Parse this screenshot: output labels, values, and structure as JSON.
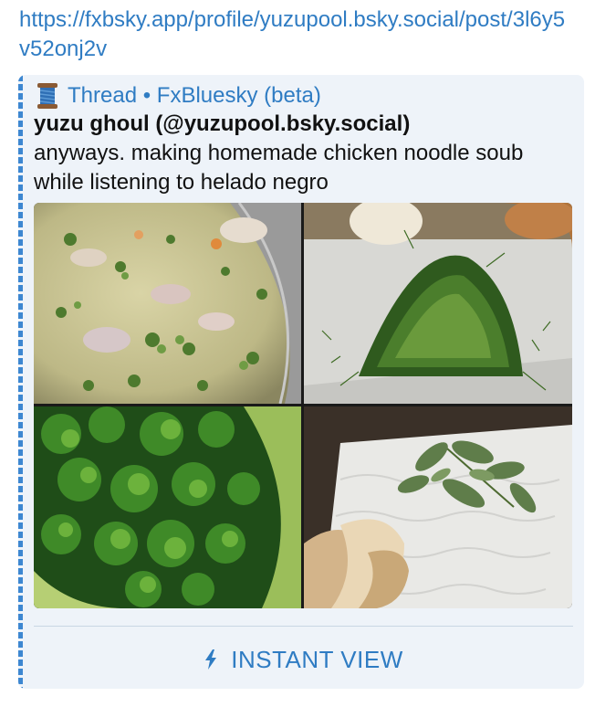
{
  "message": {
    "link_text": "https://fxbsky.app/profile/yuzupool.bsky.social/post/3l6y5v52onj2v"
  },
  "preview": {
    "site_icon": "thread-spool-icon",
    "site_name": "Thread • FxBluesky (beta)",
    "author": "yuzu ghoul (@yuzupool.bsky.social)",
    "text": "anyways. making homemade chicken noodle soub while listening to helado negro",
    "images": [
      {
        "name": "soup-photo"
      },
      {
        "name": "dill-photo"
      },
      {
        "name": "parsley-photo"
      },
      {
        "name": "sage-garlic-photo"
      }
    ],
    "instant_view": {
      "icon": "lightning-bolt-icon",
      "label": "INSTANT VIEW"
    },
    "accent_color": "#3d87d1",
    "link_color": "#2f7cc3"
  }
}
